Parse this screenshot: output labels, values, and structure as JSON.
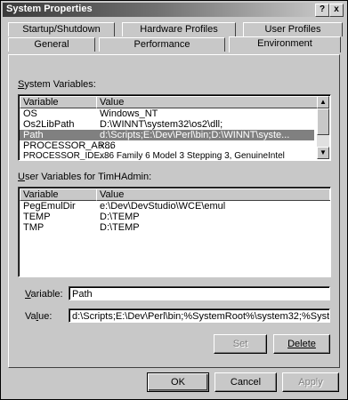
{
  "window": {
    "title": "System Properties",
    "help_label": "?",
    "close_label": "x"
  },
  "tabs_back": [
    {
      "label": "Startup/Shutdown"
    },
    {
      "label": "Hardware Profiles"
    },
    {
      "label": "User Profiles"
    }
  ],
  "tabs_front": [
    {
      "label": "General"
    },
    {
      "label": "Performance"
    },
    {
      "label": "Environment"
    }
  ],
  "system_vars": {
    "label_pre": "",
    "label_u": "S",
    "label_rest": "ystem Variables:",
    "columns": [
      "Variable",
      "Value"
    ],
    "rows": [
      {
        "variable": "OS",
        "value": "Windows_NT"
      },
      {
        "variable": "Os2LibPath",
        "value": "D:\\WINNT\\system32\\os2\\dll;"
      },
      {
        "variable": "Path",
        "value": "d:\\Scripts;E:\\Dev\\Perl\\bin;D:\\WINNT\\syste..."
      },
      {
        "variable": "PROCESSOR_AR...",
        "value": "x86"
      },
      {
        "variable": "PROCESSOR_IDE...",
        "value": "x86 Family 6 Model 3 Stepping 3, GenuineIntel"
      }
    ]
  },
  "user_vars": {
    "label_u": "U",
    "label_rest": "ser Variables for TimHAdmin:",
    "columns": [
      "Variable",
      "Value"
    ],
    "rows": [
      {
        "variable": "PegEmulDir",
        "value": "e:\\Dev\\DevStudio\\WCE\\emul"
      },
      {
        "variable": "TEMP",
        "value": "D:\\TEMP"
      },
      {
        "variable": "TMP",
        "value": "D:\\TEMP"
      }
    ]
  },
  "edit": {
    "variable_label_u": "V",
    "variable_label_rest": "ariable:",
    "variable_value": "Path",
    "value_label_pre": "Va",
    "value_label_u": "l",
    "value_label_rest": "ue:",
    "value_value": "d:\\Scripts;E:\\Dev\\Perl\\bin;%SystemRoot%\\system32;%System"
  },
  "buttons": {
    "set": "Set",
    "delete": "Delete",
    "ok": "OK",
    "cancel": "Cancel",
    "apply": "Apply"
  }
}
